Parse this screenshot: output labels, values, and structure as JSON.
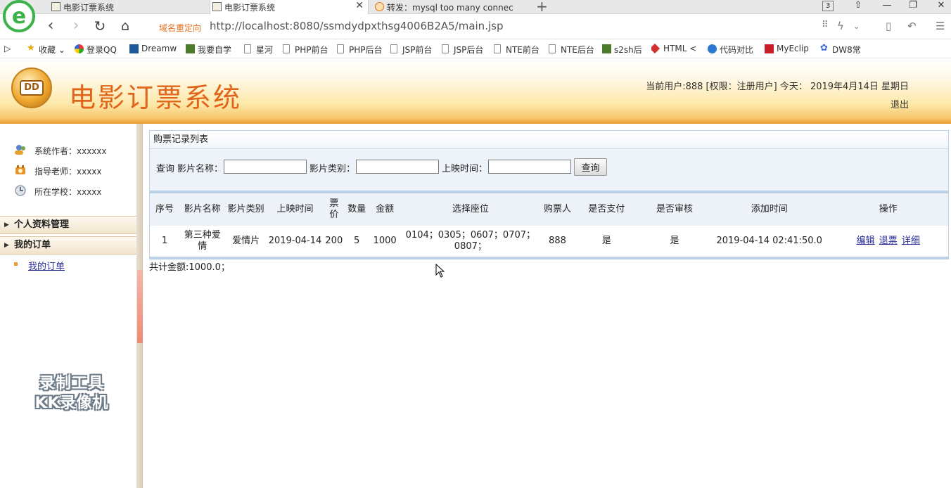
{
  "browser": {
    "tabs": [
      {
        "label": "电影订票系统"
      },
      {
        "label": "电影订票系统"
      },
      {
        "label": "转发：mysql too many connec"
      }
    ],
    "tab_count": "3",
    "redirect_label": "域名重定向",
    "url": "http://localhost:8080/ssmdydpxthsg4006B2A5/main.jsp",
    "bookmarks": [
      "收藏",
      "登录QQ",
      "Dreamw",
      "我要自学",
      "星河",
      "PHP前台",
      "PHP后台",
      "JSP前台",
      "JSP后台",
      "NTE前台",
      "NTE后台",
      "s2sh后",
      "HTML <",
      "代码对比",
      "MyEclip",
      "DW8常"
    ]
  },
  "header": {
    "logo_text": "DD",
    "title": "电影订票系统",
    "user_info": "当前用户:888 [权限：注册用户] 今天： 2019年4月14日 星期日",
    "logout": "退出"
  },
  "sidebar": {
    "info": [
      {
        "label": "系统作者：xxxxxx",
        "icon": "users-icon"
      },
      {
        "label": "指导老师：xxxxx",
        "icon": "teacher-icon"
      },
      {
        "label": "所在学校：xxxxx",
        "icon": "school-icon"
      }
    ],
    "sections": [
      {
        "label": "个人资料管理"
      },
      {
        "label": "我的订单"
      }
    ],
    "sub_items": [
      {
        "label": "我的订单"
      }
    ],
    "watermark_line1": "录制工具",
    "watermark_line2": "KK录像机"
  },
  "main": {
    "panel_title": "购票记录列表",
    "search": {
      "query_label": "查询",
      "name_label": "影片名称：",
      "type_label": "影片类别：",
      "time_label": "上映时间：",
      "name_value": "",
      "type_value": "",
      "time_value": "",
      "button": "查询"
    },
    "table": {
      "headers": [
        "序号",
        "影片名称",
        "影片类别",
        "上映时间",
        "票价",
        "数量",
        "金额",
        "选择座位",
        "购票人",
        "是否支付",
        "是否审核",
        "添加时间",
        "操作"
      ],
      "rows": [
        {
          "index": "1",
          "name": "第三种爱情",
          "type": "爱情片",
          "time": "2019-04-14",
          "price": "200",
          "qty": "5",
          "amount": "1000",
          "seats": "0104；0305；0607；0707；0807；",
          "buyer": "888",
          "paid": "是",
          "audited": "是",
          "added": "2019-04-14 02:41:50.0",
          "actions": [
            "编辑",
            "退票",
            "详细"
          ]
        }
      ]
    },
    "total": "共计金额:1000.0；"
  }
}
